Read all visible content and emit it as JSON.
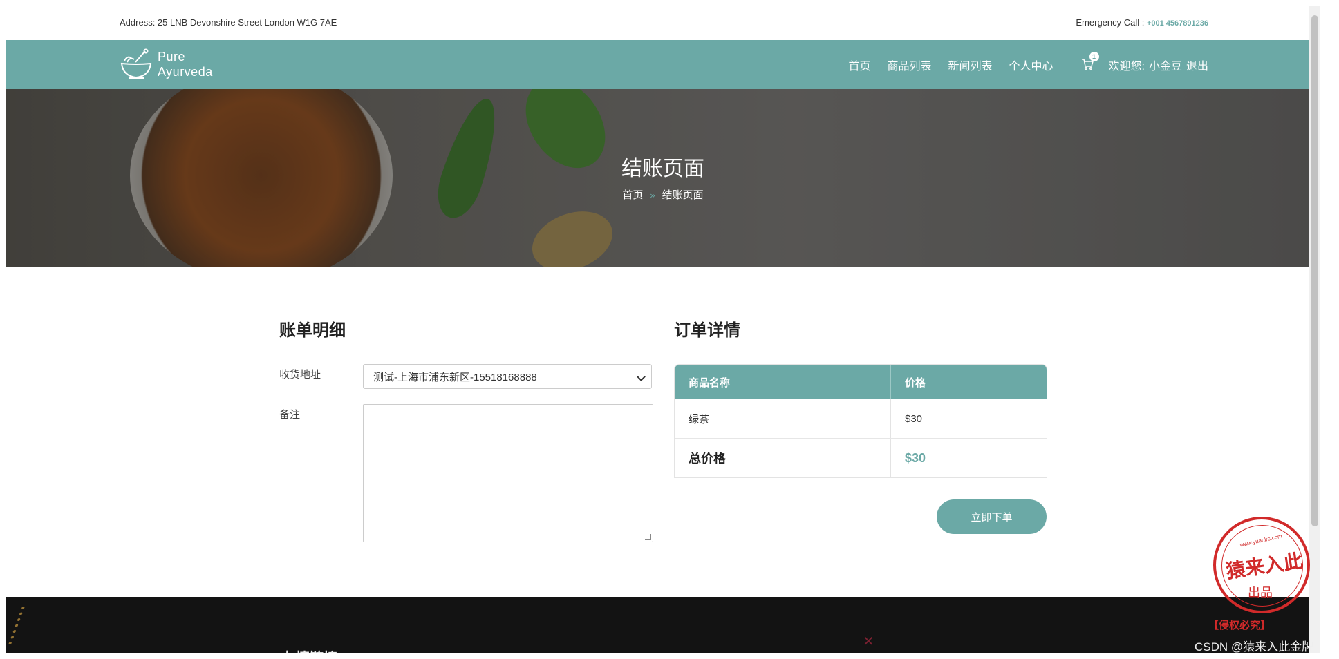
{
  "topbar": {
    "address": "Address: 25 LNB Devonshire Street London W1G 7AE",
    "emergency_label": "Emergency Call : ",
    "emergency_phone": "+001 4567891236"
  },
  "nav": {
    "logo_line1": "Pure",
    "logo_line2": "Ayurveda",
    "items": [
      {
        "label": "首页"
      },
      {
        "label": "商品列表"
      },
      {
        "label": "新闻列表"
      },
      {
        "label": "个人中心"
      }
    ],
    "cart_count": "1",
    "welcome": "欢迎您:",
    "username": "小金豆",
    "logout": "退出"
  },
  "hero": {
    "title": "结账页面",
    "breadcrumb": [
      "首页",
      "结账页面"
    ],
    "breadcrumb_sep": "»"
  },
  "billing": {
    "heading": "账单明细",
    "address_label": "收货地址",
    "address_value": "测试-上海市浦东新区-15518168888",
    "note_label": "备注",
    "note_value": ""
  },
  "order": {
    "heading": "订单详情",
    "columns": [
      "商品名称",
      "价格"
    ],
    "items": [
      {
        "name": "绿茶",
        "price": "$30"
      }
    ],
    "total_label": "总价格",
    "total_value": "$30",
    "submit_label": "立即下单"
  },
  "footer": {
    "title": "友情链接"
  },
  "watermark": {
    "stamp_text": "猿来入此",
    "stamp_sub": "出品",
    "stamp_url": "www.yuanlrc.com",
    "notice": "【侵权必究】",
    "credit": "CSDN @猿来入此金牌"
  },
  "colors": {
    "accent": "#6ba9a6",
    "footer_bg": "#131313",
    "stamp": "#d12a2a"
  }
}
